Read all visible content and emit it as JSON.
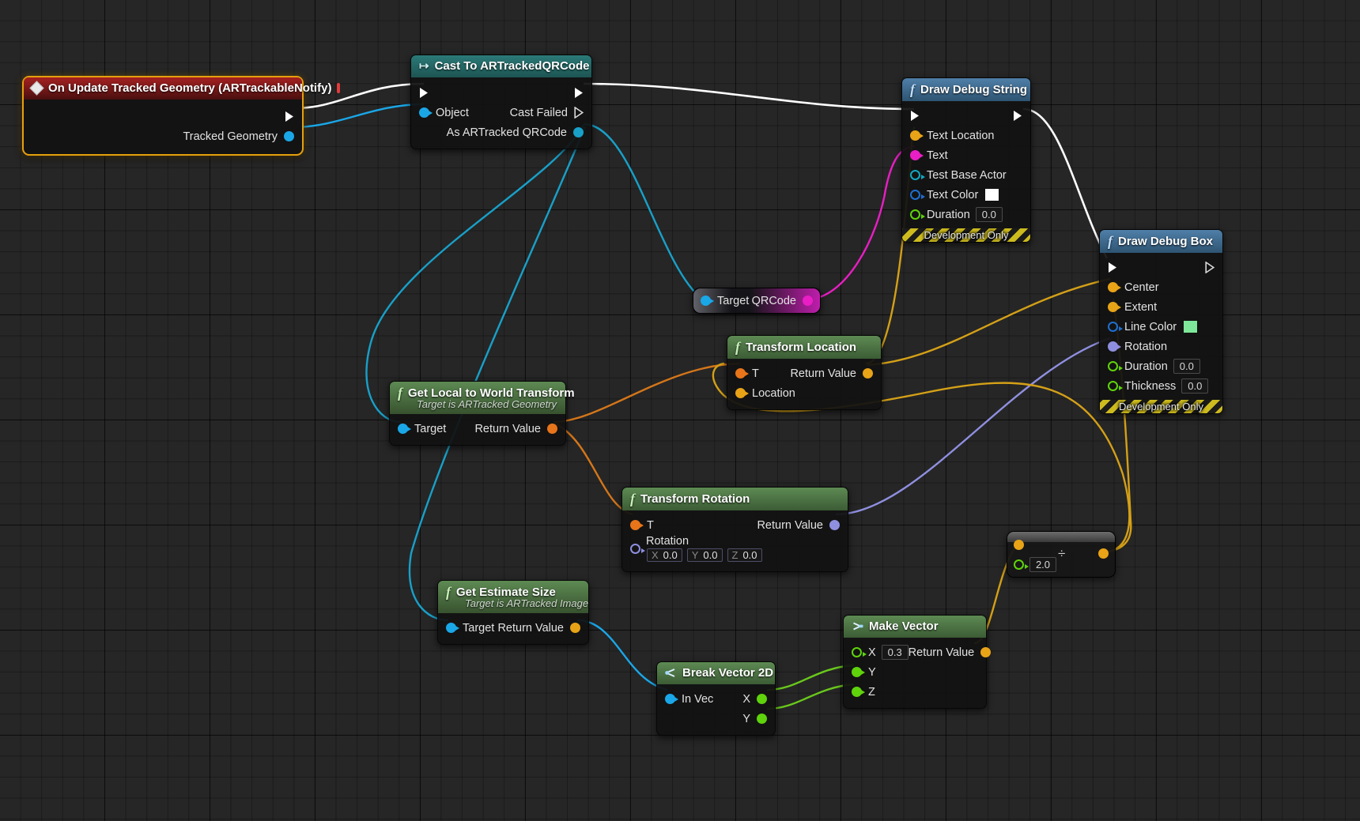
{
  "graph": {
    "title": "Unreal Engine Blueprint Event Graph",
    "background": "#262626",
    "accent": "#e5a00d"
  },
  "nodes": {
    "event": {
      "title": "On Update Tracked Geometry (ARTrackableNotify)",
      "icon": "event-diamond-icon",
      "stop_icon": "stop-recording-icon",
      "outputs": [
        {
          "label": "",
          "type": "exec"
        },
        {
          "label": "Tracked Geometry",
          "type": "object",
          "color": "#1aa7e8"
        }
      ]
    },
    "cast": {
      "title": "Cast To ARTrackedQRCode",
      "icon": "cast-arrow-icon",
      "inputs": [
        {
          "label": "",
          "type": "exec"
        },
        {
          "label": "Object",
          "type": "object",
          "color": "#1aa7e8"
        }
      ],
      "outputs": [
        {
          "label": "",
          "type": "exec"
        },
        {
          "label": "Cast Failed",
          "type": "exec"
        },
        {
          "label": "As ARTracked QRCode",
          "type": "object",
          "color": "#18a0c8"
        }
      ]
    },
    "draw_debug_string": {
      "title": "Draw Debug String",
      "icon": "function-f-icon",
      "inputs": [
        {
          "label": "",
          "type": "exec"
        },
        {
          "label": "Text Location",
          "type": "vector",
          "color": "#e8a317"
        },
        {
          "label": "Text",
          "type": "string",
          "color": "#e91ec4"
        },
        {
          "label": "Test Base Actor",
          "type": "object",
          "color": "#12a8c0"
        },
        {
          "label": "Text Color",
          "type": "linearcolor",
          "color": "#1f6fd0",
          "swatch": "#ffffff"
        },
        {
          "label": "Duration",
          "type": "float",
          "color": "#5fd30b",
          "value": "0.0"
        }
      ],
      "outputs": [
        {
          "label": "",
          "type": "exec"
        }
      ],
      "footer": "Development Only"
    },
    "draw_debug_box": {
      "title": "Draw Debug Box",
      "icon": "function-f-icon",
      "inputs": [
        {
          "label": "",
          "type": "exec"
        },
        {
          "label": "Center",
          "type": "vector",
          "color": "#e8a317"
        },
        {
          "label": "Extent",
          "type": "vector",
          "color": "#e8a317"
        },
        {
          "label": "Line Color",
          "type": "linearcolor",
          "color": "#1f6fd0",
          "swatch": "#7de89a"
        },
        {
          "label": "Rotation",
          "type": "rotator",
          "color": "#8f8fe0"
        },
        {
          "label": "Duration",
          "type": "float",
          "color": "#5fd30b",
          "value": "0.0"
        },
        {
          "label": "Thickness",
          "type": "float",
          "color": "#5fd30b",
          "value": "0.0"
        }
      ],
      "outputs": [
        {
          "label": "",
          "type": "exec"
        }
      ],
      "footer": "Development Only"
    },
    "qrcode": {
      "input_label": "Target",
      "output_label": "QRCode"
    },
    "transform_location": {
      "title": "Transform Location",
      "icon": "function-f-icon",
      "inputs": [
        {
          "label": "T",
          "type": "transform",
          "color": "#e8751a"
        },
        {
          "label": "Location",
          "type": "vector",
          "color": "#e8a317"
        }
      ],
      "outputs": [
        {
          "label": "Return Value",
          "type": "vector",
          "color": "#e8a317"
        }
      ]
    },
    "transform_rotation": {
      "title": "Transform Rotation",
      "icon": "function-f-icon",
      "inputs": [
        {
          "label": "T",
          "type": "transform",
          "color": "#e8751a"
        },
        {
          "label": "Rotation",
          "type": "rotator",
          "color": "#8f8fe0",
          "axes": [
            {
              "axis": "X",
              "value": "0.0"
            },
            {
              "axis": "Y",
              "value": "0.0"
            },
            {
              "axis": "Z",
              "value": "0.0"
            }
          ]
        }
      ],
      "outputs": [
        {
          "label": "Return Value",
          "type": "rotator",
          "color": "#8f8fe0"
        }
      ]
    },
    "get_local_to_world": {
      "title": "Get Local to World Transform",
      "subtitle": "Target is ARTracked Geometry",
      "icon": "function-f-icon",
      "inputs": [
        {
          "label": "Target",
          "type": "object",
          "color": "#1aa7e8"
        }
      ],
      "outputs": [
        {
          "label": "Return Value",
          "type": "transform",
          "color": "#e8751a"
        }
      ]
    },
    "get_estimate_size": {
      "title": "Get Estimate Size",
      "subtitle": "Target is ARTracked Image",
      "icon": "function-f-icon",
      "inputs": [
        {
          "label": "Target",
          "type": "object",
          "color": "#1aa7e8"
        }
      ],
      "outputs": [
        {
          "label": "Return Value",
          "type": "vector2d",
          "color": "#e8a317"
        }
      ]
    },
    "break_vector_2d": {
      "title": "Break Vector 2D",
      "icon": "break-struct-icon",
      "inputs": [
        {
          "label": "In Vec",
          "type": "vector2d",
          "color": "#1aa7e8"
        }
      ],
      "outputs": [
        {
          "label": "X",
          "type": "float",
          "color": "#5fd30b"
        },
        {
          "label": "Y",
          "type": "float",
          "color": "#5fd30b"
        }
      ]
    },
    "make_vector": {
      "title": "Make Vector",
      "icon": "make-struct-icon",
      "inputs": [
        {
          "label": "X",
          "type": "float",
          "color": "#5fd30b",
          "value": "0.3"
        },
        {
          "label": "Y",
          "type": "float",
          "color": "#5fd30b"
        },
        {
          "label": "Z",
          "type": "float",
          "color": "#5fd30b"
        }
      ],
      "outputs": [
        {
          "label": "Return Value",
          "type": "vector",
          "color": "#e8a317"
        }
      ]
    },
    "divide": {
      "title": "",
      "operator": "÷",
      "inputs": [
        {
          "label": "",
          "type": "vector",
          "color": "#e8a317"
        },
        {
          "label": "",
          "type": "float",
          "color": "#5fd30b",
          "value": "2.0"
        }
      ],
      "outputs": [
        {
          "label": "",
          "type": "vector",
          "color": "#e8a317"
        }
      ]
    }
  }
}
